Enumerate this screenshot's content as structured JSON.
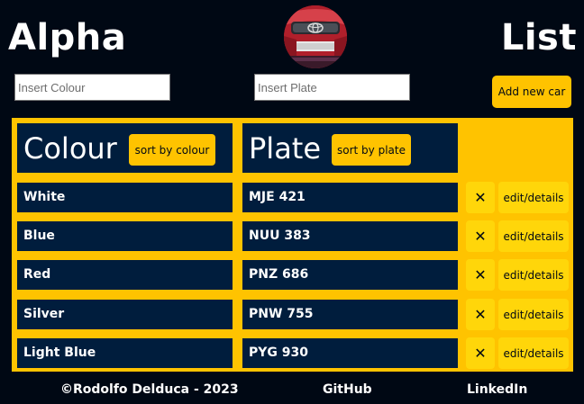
{
  "header": {
    "title_left": "Alpha",
    "title_right": "List",
    "logo_icon": "toyota-car-logo-icon"
  },
  "form": {
    "colour_placeholder": "Insert Colour",
    "plate_placeholder": "Insert Plate",
    "add_label": "Add new car"
  },
  "table": {
    "colour_header": "Colour",
    "plate_header": "Plate",
    "sort_colour_label": "sort by colour",
    "sort_plate_label": "sort by plate",
    "delete_icon": "close-icon",
    "delete_glyph": "✕",
    "edit_label": "edit/details",
    "rows": [
      {
        "colour": "White",
        "plate": "MJE 421"
      },
      {
        "colour": "Blue",
        "plate": "NUU 383"
      },
      {
        "colour": "Red",
        "plate": "PNZ 686"
      },
      {
        "colour": "Silver",
        "plate": "PNW 755"
      },
      {
        "colour": "Light Blue",
        "plate": "PYG 930"
      }
    ]
  },
  "footer": {
    "copyright": "©Rodolfo Delduca - 2023",
    "github": "GitHub",
    "linkedin": "LinkedIn"
  },
  "colors": {
    "background": "#000814",
    "panel": "#001d3d",
    "accent": "#ffc300",
    "button": "#ffd60a"
  }
}
